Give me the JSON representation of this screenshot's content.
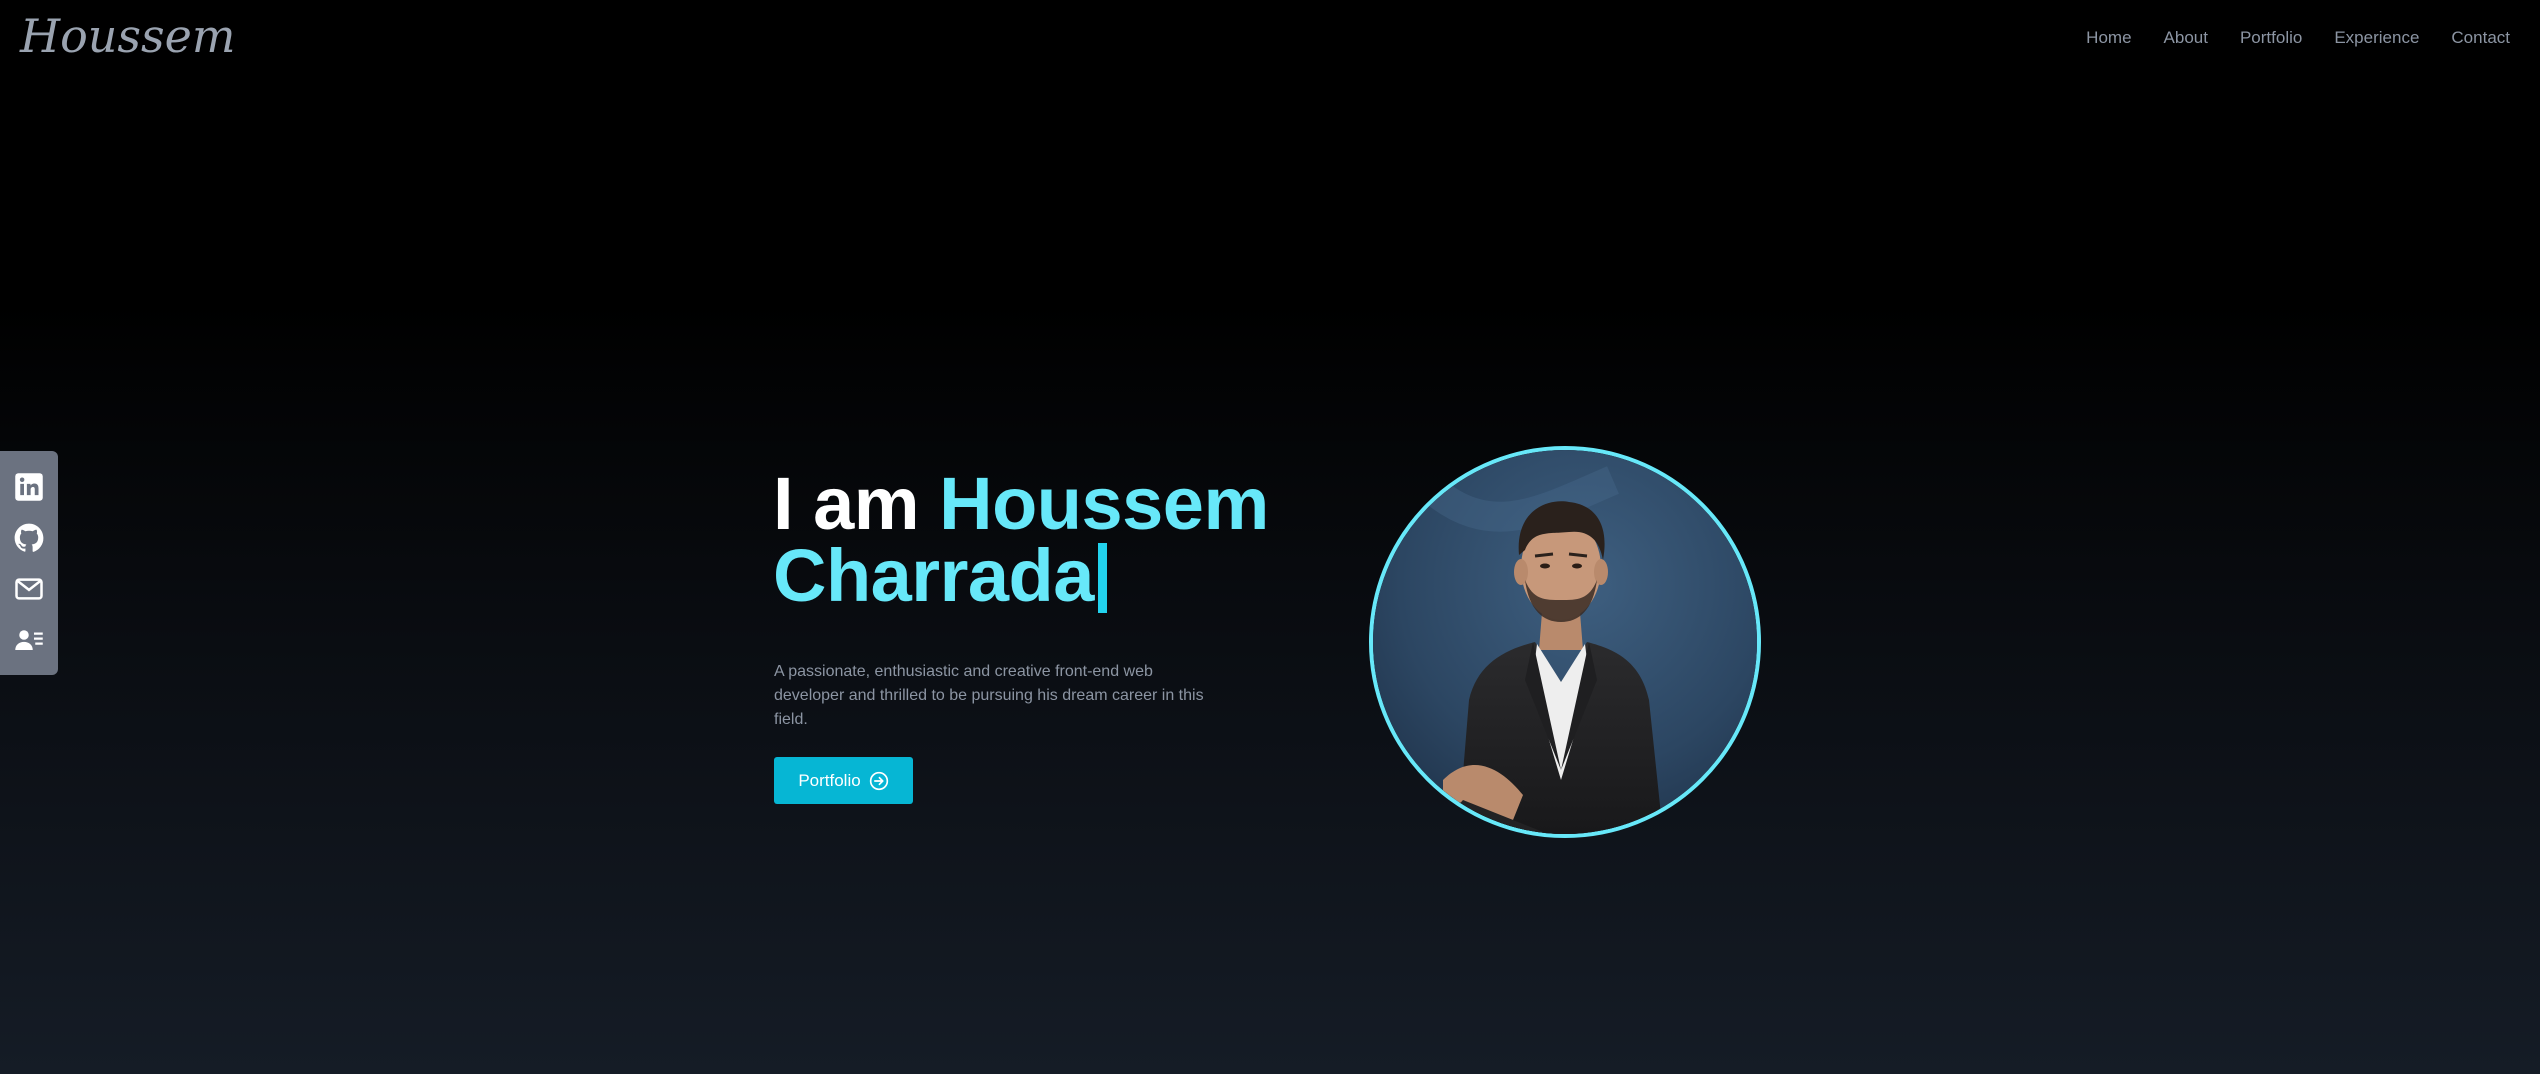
{
  "header": {
    "logo": "Houssem",
    "nav": [
      "Home",
      "About",
      "Portfolio",
      "Experience",
      "Contact"
    ]
  },
  "social": [
    {
      "icon": "linkedin-icon"
    },
    {
      "icon": "github-icon"
    },
    {
      "icon": "mail-icon"
    },
    {
      "icon": "contact-card-icon"
    }
  ],
  "hero": {
    "greeting": "I am ",
    "name_first": "Houssem",
    "name_last": "Charrada",
    "description": "A passionate, enthusiastic and creative front-end web developer and thrilled to be pursuing his dream career in this field.",
    "cta_label": "Portfolio"
  },
  "colors": {
    "accent": "#67e8f9",
    "button": "#06b6d4",
    "muted_text": "#8c95a3",
    "sidebar": "#6b7280"
  }
}
